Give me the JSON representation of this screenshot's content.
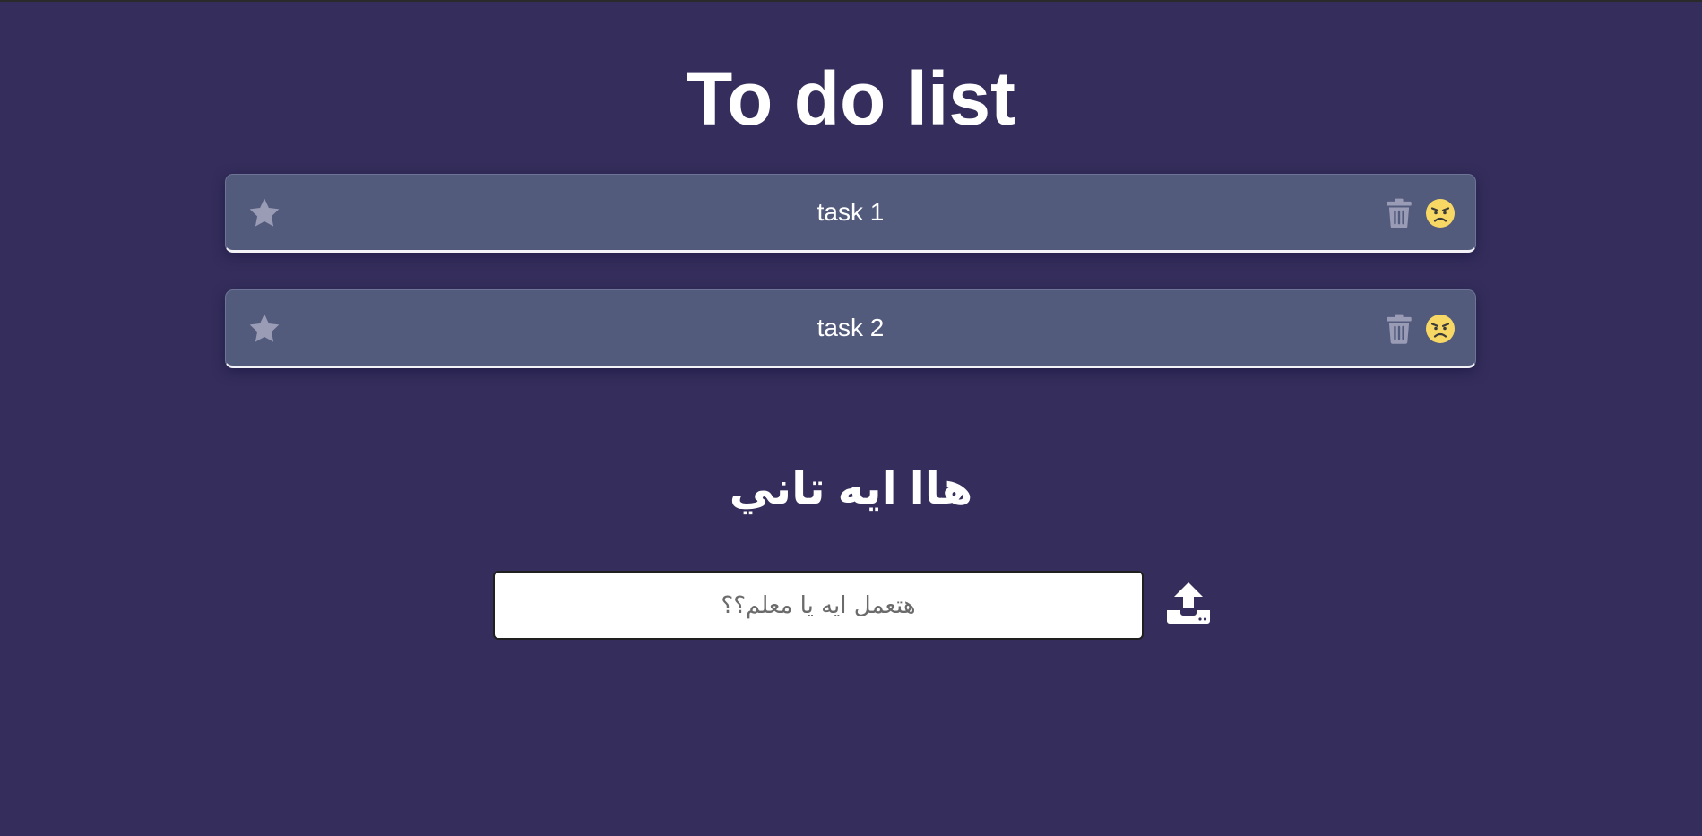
{
  "header": {
    "title": "To do list"
  },
  "tasks": [
    {
      "label": "task 1",
      "star_icon": "star-icon",
      "delete_icon": "trash-icon",
      "mood_icon": "angry-face-icon"
    },
    {
      "label": "task 2",
      "star_icon": "star-icon",
      "delete_icon": "trash-icon",
      "mood_icon": "angry-face-icon"
    }
  ],
  "new_task": {
    "heading": "هاا ايه تاني",
    "placeholder": "هتعمل ايه يا معلم؟؟",
    "value": "",
    "submit_icon": "upload-icon"
  },
  "colors": {
    "background": "#352e5c",
    "card": "#535b7d",
    "card_border_bottom": "#f2f2f7",
    "icon_muted": "#9a9cb6",
    "emoji_face": "#f8d865",
    "text": "#ffffff"
  }
}
